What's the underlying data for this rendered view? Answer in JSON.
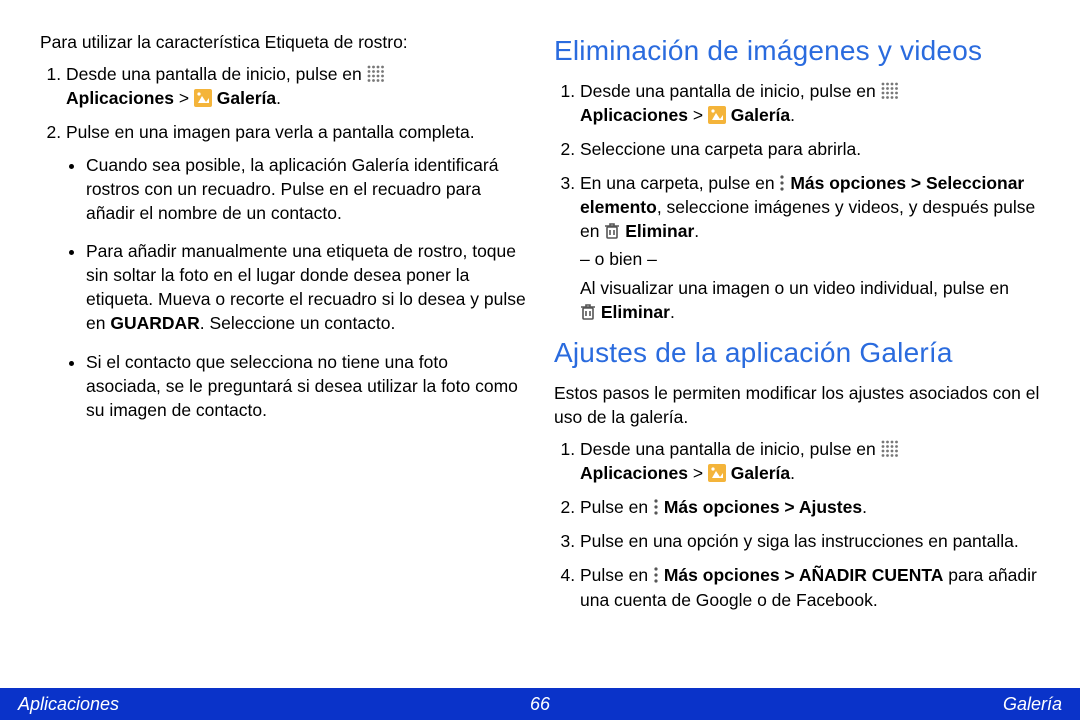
{
  "left": {
    "intro": "Para utilizar la característica Etiqueta de rostro:",
    "step1_a": "Desde una pantalla de inicio, pulse en ",
    "step1_apps": "Aplicaciones",
    "step1_gt": " > ",
    "step1_gallery": " Galería",
    "step1_dot": ".",
    "step2": "Pulse en una imagen para verla a pantalla completa.",
    "bullet1": "Cuando sea posible, la aplicación Galería identificará rostros con un recuadro. Pulse en el recuadro para añadir el nombre de un contacto.",
    "bullet2_a": "Para añadir manualmente una etiqueta de rostro, toque sin soltar la foto en el lugar donde desea poner la etiqueta. Mueva o recorte el recuadro si lo desea y pulse en ",
    "bullet2_guardar": "GUARDAR",
    "bullet2_b": ". Seleccione un contacto.",
    "bullet3": "Si el contacto que selecciona no tiene una foto asociada, se le preguntará si desea utilizar la foto como su imagen de contacto."
  },
  "right": {
    "h_delete": "Eliminación de imágenes y videos",
    "d_step1_a": "Desde una pantalla de inicio, pulse en ",
    "d_step1_apps": "Aplicaciones",
    "d_step1_gt": " > ",
    "d_step1_gallery": " Galería",
    "d_step1_dot": ".",
    "d_step2": "Seleccione una carpeta para abrirla.",
    "d_step3_a": "En una carpeta, pulse en ",
    "d_step3_more": " Más opciones > Seleccionar elemento",
    "d_step3_b": ", seleccione imágenes y videos, y después pulse en ",
    "d_step3_del": " Eliminar",
    "d_step3_dot": ".",
    "d_or": "– o bien –",
    "d_alt_a": "Al visualizar una imagen o un video individual, pulse en ",
    "d_alt_del": " Eliminar",
    "d_alt_dot": ".",
    "h_settings": "Ajustes de la aplicación Galería",
    "s_intro": "Estos pasos le permiten modificar los ajustes asociados con el uso de la galería.",
    "s_step1_a": "Desde una pantalla de inicio, pulse en ",
    "s_step1_apps": "Aplicaciones",
    "s_step1_gt": " > ",
    "s_step1_gallery": " Galería",
    "s_step1_dot": ".",
    "s_step2_a": "Pulse en ",
    "s_step2_more": " Más opciones > Ajustes",
    "s_step2_dot": ".",
    "s_step3": "Pulse en una opción y siga las instrucciones en pantalla.",
    "s_step4_a": "Pulse en ",
    "s_step4_more": " Más opciones > AÑADIR CUENTA",
    "s_step4_b": " para añadir una cuenta de Google o de Facebook."
  },
  "footer": {
    "left": "Aplicaciones",
    "center": "66",
    "right": "Galería"
  }
}
